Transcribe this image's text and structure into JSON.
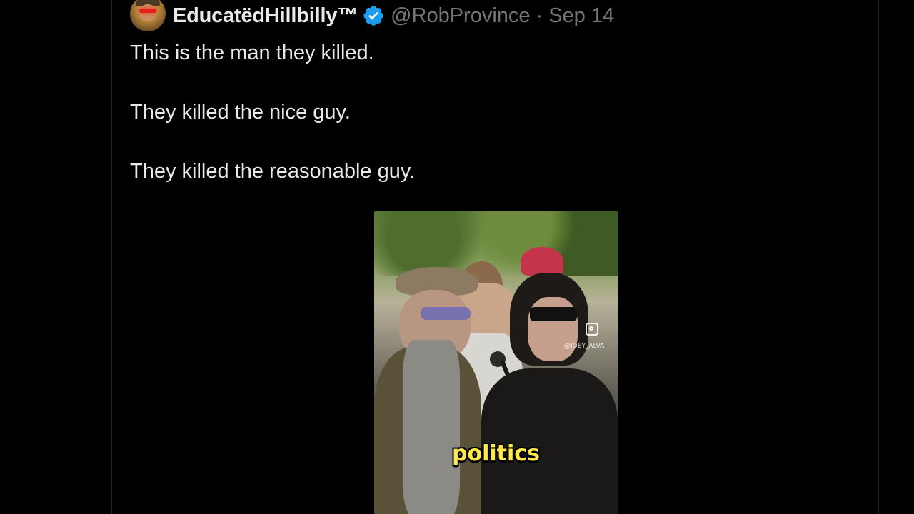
{
  "tweet": {
    "author": {
      "display_name": "EducatëdHillbilly™",
      "handle": "@RobProvince",
      "separator": "·",
      "date": "Sep 14",
      "verified": true,
      "verified_color": "#1d9bf0"
    },
    "text_lines": [
      "This is the man they killed.",
      "They killed the nice guy.",
      "They killed the reasonable guy."
    ],
    "media": {
      "type": "video",
      "caption": "politics",
      "watermark": "@JOEY_ALVA"
    }
  },
  "colors": {
    "background": "#000000",
    "text_primary": "#e7e9ea",
    "text_secondary": "#71767b",
    "caption_yellow": "#ffe94a"
  }
}
